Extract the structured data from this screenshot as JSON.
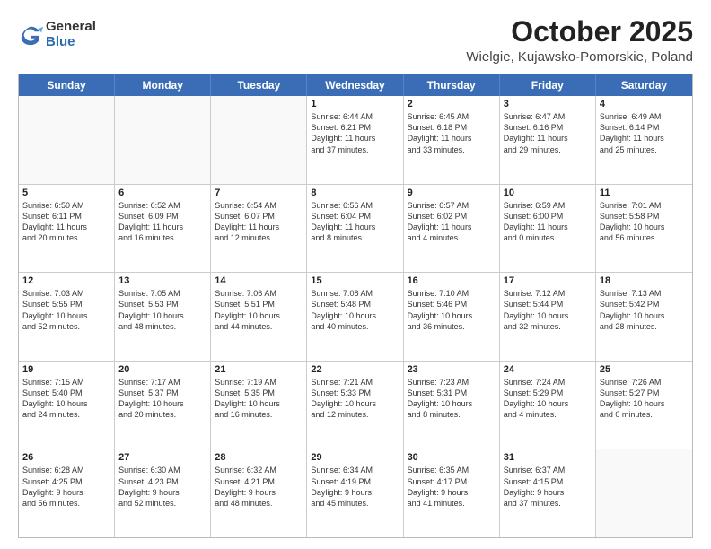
{
  "logo": {
    "general": "General",
    "blue": "Blue"
  },
  "title": "October 2025",
  "subtitle": "Wielgie, Kujawsko-Pomorskie, Poland",
  "headers": [
    "Sunday",
    "Monday",
    "Tuesday",
    "Wednesday",
    "Thursday",
    "Friday",
    "Saturday"
  ],
  "weeks": [
    [
      {
        "day": "",
        "info": ""
      },
      {
        "day": "",
        "info": ""
      },
      {
        "day": "",
        "info": ""
      },
      {
        "day": "1",
        "info": "Sunrise: 6:44 AM\nSunset: 6:21 PM\nDaylight: 11 hours\nand 37 minutes."
      },
      {
        "day": "2",
        "info": "Sunrise: 6:45 AM\nSunset: 6:18 PM\nDaylight: 11 hours\nand 33 minutes."
      },
      {
        "day": "3",
        "info": "Sunrise: 6:47 AM\nSunset: 6:16 PM\nDaylight: 11 hours\nand 29 minutes."
      },
      {
        "day": "4",
        "info": "Sunrise: 6:49 AM\nSunset: 6:14 PM\nDaylight: 11 hours\nand 25 minutes."
      }
    ],
    [
      {
        "day": "5",
        "info": "Sunrise: 6:50 AM\nSunset: 6:11 PM\nDaylight: 11 hours\nand 20 minutes."
      },
      {
        "day": "6",
        "info": "Sunrise: 6:52 AM\nSunset: 6:09 PM\nDaylight: 11 hours\nand 16 minutes."
      },
      {
        "day": "7",
        "info": "Sunrise: 6:54 AM\nSunset: 6:07 PM\nDaylight: 11 hours\nand 12 minutes."
      },
      {
        "day": "8",
        "info": "Sunrise: 6:56 AM\nSunset: 6:04 PM\nDaylight: 11 hours\nand 8 minutes."
      },
      {
        "day": "9",
        "info": "Sunrise: 6:57 AM\nSunset: 6:02 PM\nDaylight: 11 hours\nand 4 minutes."
      },
      {
        "day": "10",
        "info": "Sunrise: 6:59 AM\nSunset: 6:00 PM\nDaylight: 11 hours\nand 0 minutes."
      },
      {
        "day": "11",
        "info": "Sunrise: 7:01 AM\nSunset: 5:58 PM\nDaylight: 10 hours\nand 56 minutes."
      }
    ],
    [
      {
        "day": "12",
        "info": "Sunrise: 7:03 AM\nSunset: 5:55 PM\nDaylight: 10 hours\nand 52 minutes."
      },
      {
        "day": "13",
        "info": "Sunrise: 7:05 AM\nSunset: 5:53 PM\nDaylight: 10 hours\nand 48 minutes."
      },
      {
        "day": "14",
        "info": "Sunrise: 7:06 AM\nSunset: 5:51 PM\nDaylight: 10 hours\nand 44 minutes."
      },
      {
        "day": "15",
        "info": "Sunrise: 7:08 AM\nSunset: 5:48 PM\nDaylight: 10 hours\nand 40 minutes."
      },
      {
        "day": "16",
        "info": "Sunrise: 7:10 AM\nSunset: 5:46 PM\nDaylight: 10 hours\nand 36 minutes."
      },
      {
        "day": "17",
        "info": "Sunrise: 7:12 AM\nSunset: 5:44 PM\nDaylight: 10 hours\nand 32 minutes."
      },
      {
        "day": "18",
        "info": "Sunrise: 7:13 AM\nSunset: 5:42 PM\nDaylight: 10 hours\nand 28 minutes."
      }
    ],
    [
      {
        "day": "19",
        "info": "Sunrise: 7:15 AM\nSunset: 5:40 PM\nDaylight: 10 hours\nand 24 minutes."
      },
      {
        "day": "20",
        "info": "Sunrise: 7:17 AM\nSunset: 5:37 PM\nDaylight: 10 hours\nand 20 minutes."
      },
      {
        "day": "21",
        "info": "Sunrise: 7:19 AM\nSunset: 5:35 PM\nDaylight: 10 hours\nand 16 minutes."
      },
      {
        "day": "22",
        "info": "Sunrise: 7:21 AM\nSunset: 5:33 PM\nDaylight: 10 hours\nand 12 minutes."
      },
      {
        "day": "23",
        "info": "Sunrise: 7:23 AM\nSunset: 5:31 PM\nDaylight: 10 hours\nand 8 minutes."
      },
      {
        "day": "24",
        "info": "Sunrise: 7:24 AM\nSunset: 5:29 PM\nDaylight: 10 hours\nand 4 minutes."
      },
      {
        "day": "25",
        "info": "Sunrise: 7:26 AM\nSunset: 5:27 PM\nDaylight: 10 hours\nand 0 minutes."
      }
    ],
    [
      {
        "day": "26",
        "info": "Sunrise: 6:28 AM\nSunset: 4:25 PM\nDaylight: 9 hours\nand 56 minutes."
      },
      {
        "day": "27",
        "info": "Sunrise: 6:30 AM\nSunset: 4:23 PM\nDaylight: 9 hours\nand 52 minutes."
      },
      {
        "day": "28",
        "info": "Sunrise: 6:32 AM\nSunset: 4:21 PM\nDaylight: 9 hours\nand 48 minutes."
      },
      {
        "day": "29",
        "info": "Sunrise: 6:34 AM\nSunset: 4:19 PM\nDaylight: 9 hours\nand 45 minutes."
      },
      {
        "day": "30",
        "info": "Sunrise: 6:35 AM\nSunset: 4:17 PM\nDaylight: 9 hours\nand 41 minutes."
      },
      {
        "day": "31",
        "info": "Sunrise: 6:37 AM\nSunset: 4:15 PM\nDaylight: 9 hours\nand 37 minutes."
      },
      {
        "day": "",
        "info": ""
      }
    ]
  ]
}
